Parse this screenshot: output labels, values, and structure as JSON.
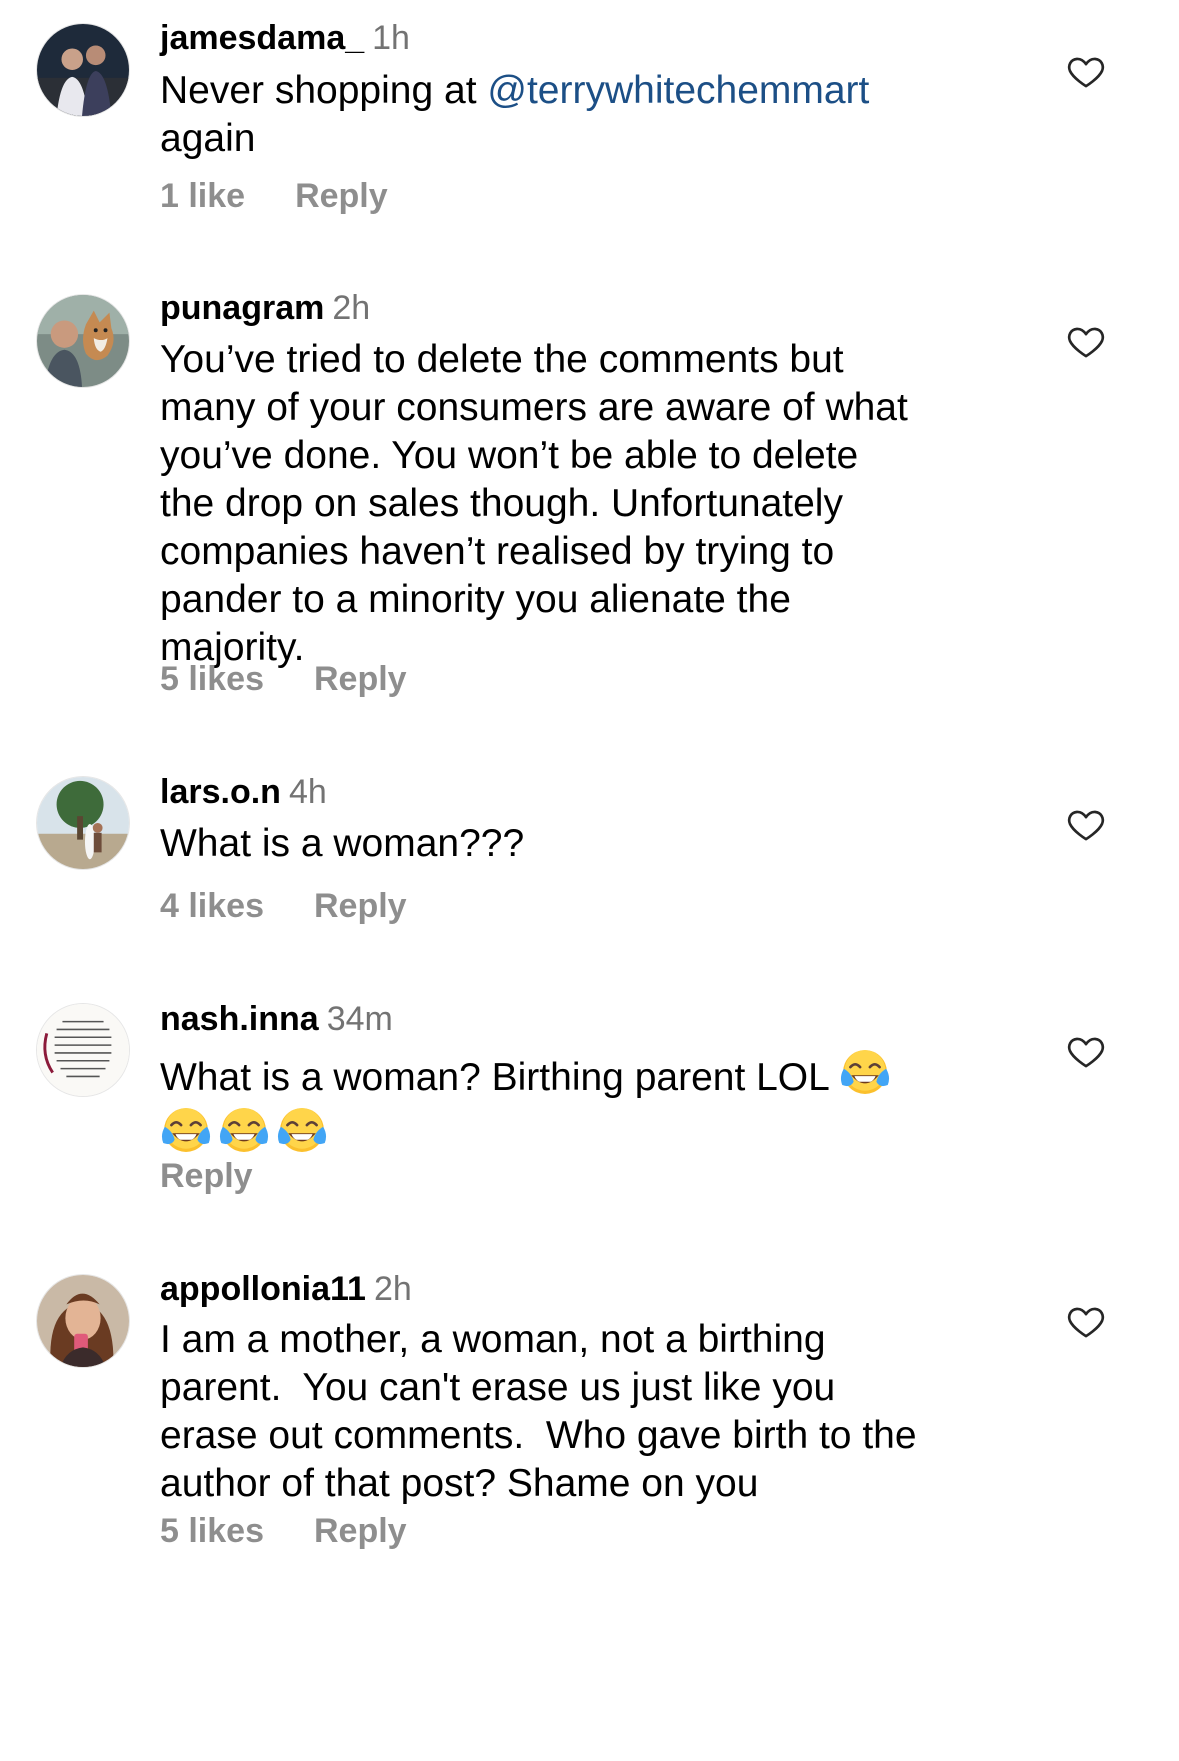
{
  "comments": [
    {
      "username": "jamesdama_",
      "time": "1h",
      "text_lines": [
        [
          "Never shopping at ",
          "@terrywhitechemmart"
        ],
        [
          "again",
          ""
        ]
      ],
      "likes": "1 like",
      "reply": "Reply"
    },
    {
      "username": "punagram",
      "time": "2h",
      "text_lines": [
        "You’ve tried to delete the comments but",
        "many of your consumers are aware of what",
        "you’ve done. You won’t be able to delete",
        "the drop on sales though. Unfortunately",
        "companies haven’t realised by trying to",
        "pander to a minority you alienate the",
        "majority."
      ],
      "likes": "5 likes",
      "reply": "Reply"
    },
    {
      "username": "lars.o.n",
      "time": "4h",
      "text_lines": [
        "What is a woman???"
      ],
      "likes": "4 likes",
      "reply": "Reply"
    },
    {
      "username": "nash.inna",
      "time": "34m",
      "text_lines": [
        "What is a woman? Birthing parent LOL"
      ],
      "emoji": "face-with-tears-of-joy",
      "reply": "Reply"
    },
    {
      "username": "appollonia11",
      "time": "2h",
      "text_lines": [
        "I am a mother, a woman, not a birthing",
        "parent.  You can't erase us just like you",
        "erase out comments.  Who gave birth to the",
        "author of that post? Shame on you"
      ],
      "likes": "5 likes",
      "reply": "Reply"
    }
  ],
  "colors": {
    "username": "#000000",
    "meta": "#737373",
    "action": "#8e8e8e",
    "mention": "#1c4f86",
    "heart_outline": "#262626"
  },
  "icons": {
    "like": "heart-outline-icon",
    "emoji": "face-with-tears-of-joy-icon"
  }
}
